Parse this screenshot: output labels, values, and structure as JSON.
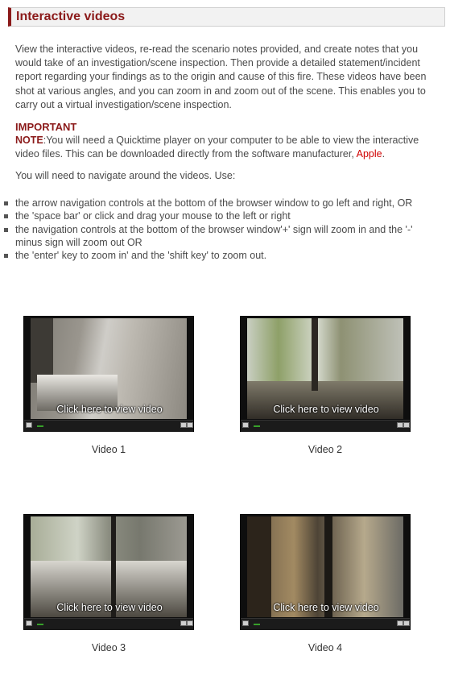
{
  "header": {
    "title": "Interactive videos"
  },
  "intro": "View the interactive videos, re-read the scenario notes provided, and create notes that you would take of an investigation/scene inspection. Then provide a detailed statement/incident report regarding your findings as to the origin and cause of this fire. These videos have been shot at various angles, and you can zoom in and zoom out of the scene. This enables you to carry out a virtual investigation/scene inspection.",
  "important": {
    "title": "IMPORTANT",
    "note_label": "NOTE",
    "note_text": ":You will need a Quicktime player on your computer to be able to view the interactive video files. This can be downloaded directly from the software manufacturer, ",
    "link_text": "Apple",
    "after_link": "."
  },
  "navigate_text": "You will need to navigate around the videos. Use:",
  "bullets": [
    "the arrow navigation controls at the bottom of the browser window to go left and right, OR",
    "the 'space bar' or click and drag your mouse to the left or right",
    "the navigation controls at the bottom of the browser window'+' sign will zoom in and the '-' minus sign will zoom out OR",
    "the 'enter' key to zoom in' and the 'shift key' to zoom out."
  ],
  "videos": [
    {
      "overlay": "Click here to view video",
      "caption": "Video 1"
    },
    {
      "overlay": "Click here to view video",
      "caption": "Video 2"
    },
    {
      "overlay": "Click here to view video",
      "caption": "Video 3"
    },
    {
      "overlay": "Click here to view video",
      "caption": "Video 4"
    }
  ],
  "colors": {
    "accent": "#8b1a1a",
    "link": "#d00000"
  }
}
